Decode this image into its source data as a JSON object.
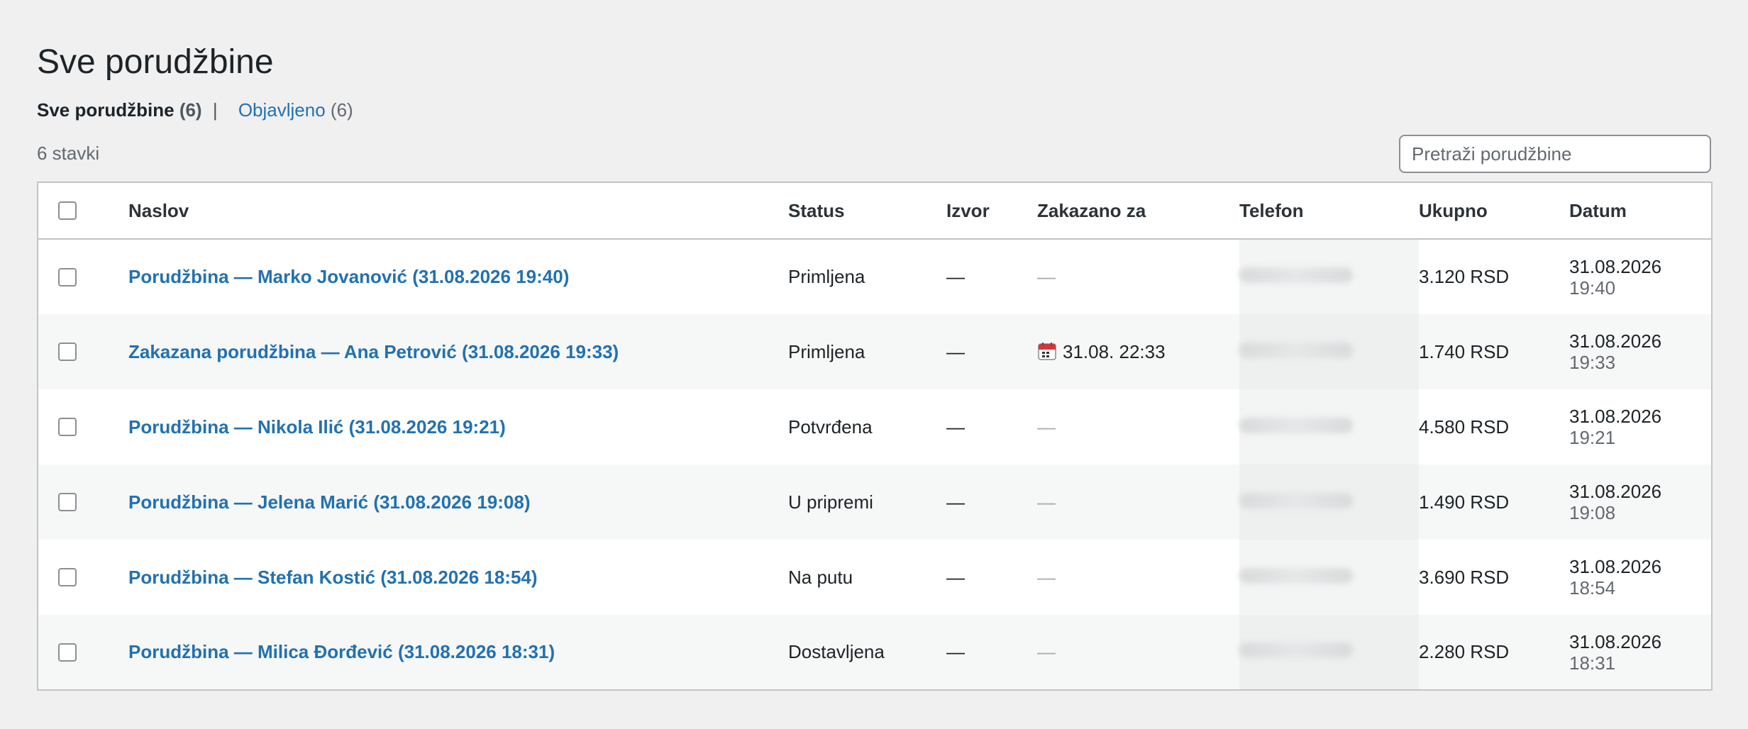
{
  "page": {
    "title": "Sve porudžbine"
  },
  "views": {
    "all_label": "Sve porudžbine",
    "all_count": "(6)",
    "separator": "|",
    "published_label": "Objavljeno",
    "published_count": "(6)"
  },
  "item_count": "6 stavki",
  "search": {
    "placeholder": "Pretraži porudžbine"
  },
  "table": {
    "columns": {
      "title": "Naslov",
      "status": "Status",
      "source": "Izvor",
      "scheduled": "Zakazano za",
      "phone": "Telefon",
      "total": "Ukupno",
      "date": "Datum"
    },
    "rows": [
      {
        "title": "Porudžbina — Marko Jovanović (31.08.2026 19:40)",
        "status": "Primljena",
        "source": "—",
        "scheduled": "—",
        "scheduled_icon": "",
        "total": "3.120 RSD",
        "date": "31.08.2026",
        "time": "19:40"
      },
      {
        "title": "Zakazana porudžbina — Ana Petrović (31.08.2026 19:33)",
        "status": "Primljena",
        "source": "—",
        "scheduled": "31.08. 22:33",
        "scheduled_icon": "calendar-icon",
        "total": "1.740 RSD",
        "date": "31.08.2026",
        "time": "19:33"
      },
      {
        "title": "Porudžbina — Nikola Ilić (31.08.2026 19:21)",
        "status": "Potvrđena",
        "source": "—",
        "scheduled": "—",
        "scheduled_icon": "",
        "total": "4.580 RSD",
        "date": "31.08.2026",
        "time": "19:21"
      },
      {
        "title": "Porudžbina — Jelena Marić (31.08.2026 19:08)",
        "status": "U pripremi",
        "source": "—",
        "scheduled": "—",
        "scheduled_icon": "",
        "total": "1.490 RSD",
        "date": "31.08.2026",
        "time": "19:08"
      },
      {
        "title": "Porudžbina — Stefan Kostić (31.08.2026 18:54)",
        "status": "Na putu",
        "source": "—",
        "scheduled": "—",
        "scheduled_icon": "",
        "total": "3.690 RSD",
        "date": "31.08.2026",
        "time": "18:54"
      },
      {
        "title": "Porudžbina — Milica Đorđević (31.08.2026 18:31)",
        "status": "Dostavljena",
        "source": "—",
        "scheduled": "—",
        "scheduled_icon": "",
        "total": "2.280 RSD",
        "date": "31.08.2026",
        "time": "18:31"
      }
    ]
  },
  "colors": {
    "link": "#2271b1",
    "background": "#f0f0f1",
    "text": "#1d2327",
    "muted": "#646970"
  }
}
